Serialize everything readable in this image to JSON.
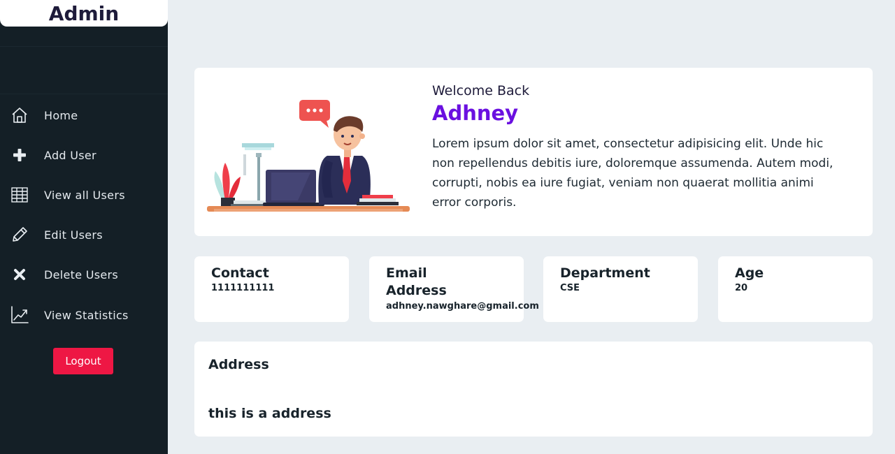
{
  "sidebar": {
    "brand": "Admin",
    "items": [
      {
        "label": "Home",
        "icon": "home-icon"
      },
      {
        "label": "Add User",
        "icon": "plus-icon"
      },
      {
        "label": "View all Users",
        "icon": "table-icon"
      },
      {
        "label": "Edit Users",
        "icon": "pencil-icon"
      },
      {
        "label": "Delete Users",
        "icon": "close-icon"
      },
      {
        "label": "View Statistics",
        "icon": "chart-line-icon"
      }
    ],
    "logout_label": "Logout"
  },
  "welcome": {
    "greeting": "Welcome Back",
    "name": "Adhney",
    "description": "Lorem ipsum dolor sit amet, consectetur adipisicing elit. Unde hic non repellendus debitis iure, doloremque assumenda. Autem modi, corrupti, nobis ea iure fugiat, veniam non quaerat mollitia animi error corporis."
  },
  "info": [
    {
      "title": "Contact",
      "value": "1111111111"
    },
    {
      "title": "Email Address",
      "value": "adhney.nawghare@gmail.com"
    },
    {
      "title": "Department",
      "value": "CSE"
    },
    {
      "title": "Age",
      "value": "20"
    }
  ],
  "address": {
    "title": "Address",
    "value": "this is a address"
  },
  "colors": {
    "sidebar_bg": "#141f26",
    "page_bg": "#e9eef2",
    "accent": "#6a10e0",
    "logout": "#ee1744"
  }
}
